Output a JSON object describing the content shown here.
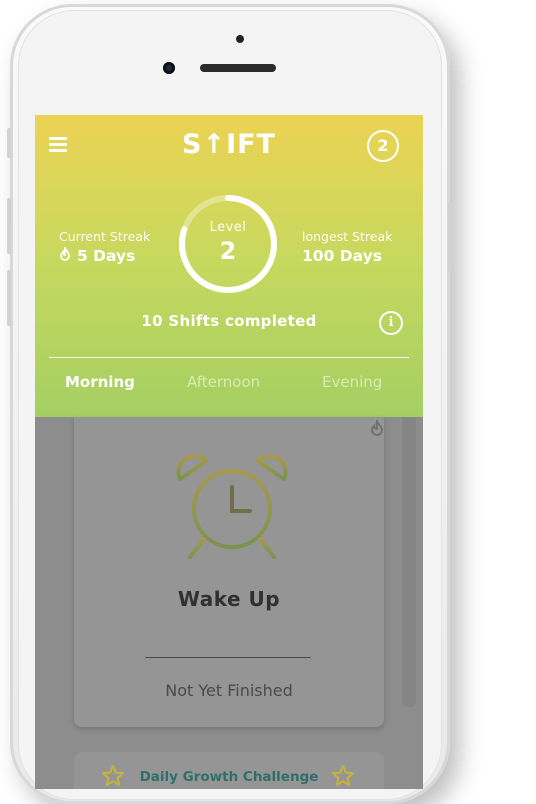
{
  "app": {
    "logo": "S↑IFT",
    "notification_count": "2"
  },
  "stats": {
    "current_streak_label": "Current Streak",
    "current_streak_value": "5 Days",
    "longest_streak_label": "longest Streak",
    "longest_streak_value": "100 Days",
    "level_label": "Level",
    "level_value": "2",
    "level_progress": 0.8,
    "shifts_completed": "10 Shifts completed"
  },
  "tabs": [
    {
      "label": "Morning",
      "active": true
    },
    {
      "label": "Afternoon",
      "active": false
    },
    {
      "label": "Evening",
      "active": false
    }
  ],
  "card": {
    "icon": "alarm-clock-icon",
    "title": "Wake Up",
    "status": "Not Yet Finished"
  },
  "challenge": {
    "title": "Daily Growth Challenge"
  },
  "colors": {
    "header_top": "#ecd253",
    "header_bottom": "#a4cf62",
    "overlay": "#8d8d8d",
    "challenge_text": "#2f6f6a",
    "star": "#c9b43a"
  }
}
